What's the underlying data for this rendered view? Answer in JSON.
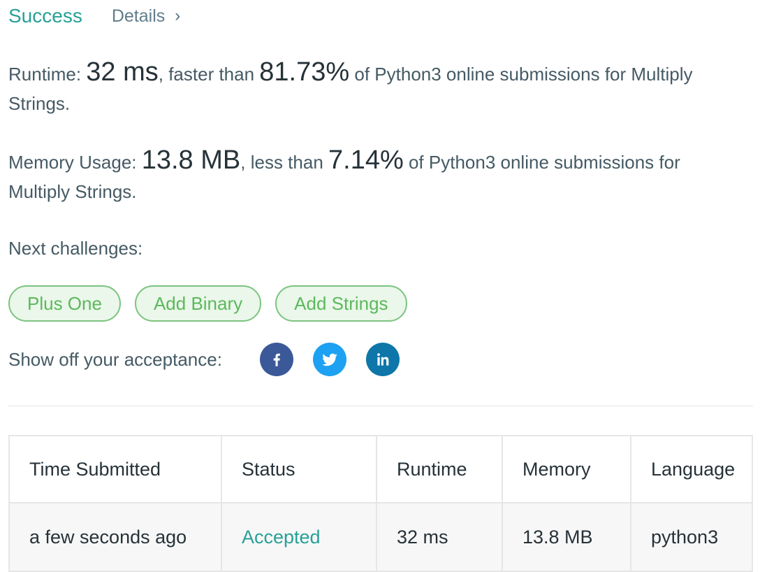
{
  "header": {
    "status": "Success",
    "details_label": "Details",
    "chevron": "›"
  },
  "runtime": {
    "label": "Runtime: ",
    "value": "32 ms",
    "compare": ", faster than ",
    "percent": "81.73%",
    "tail": " of Python3 online submissions for Multiply Strings."
  },
  "memory": {
    "label": "Memory Usage: ",
    "value": "13.8 MB",
    "compare": ", less than ",
    "percent": "7.14%",
    "tail": " of Python3 online submissions for Multiply Strings."
  },
  "next": {
    "label": "Next challenges:",
    "items": [
      "Plus One",
      "Add Binary",
      "Add Strings"
    ]
  },
  "share": {
    "label": "Show off your acceptance:",
    "icons": [
      "facebook-icon",
      "twitter-icon",
      "linkedin-icon"
    ]
  },
  "table": {
    "headers": [
      "Time Submitted",
      "Status",
      "Runtime",
      "Memory",
      "Language"
    ],
    "row": [
      "a few seconds ago",
      "Accepted",
      "32 ms",
      "13.8 MB",
      "python3"
    ]
  },
  "colors": {
    "accent": "#26a197",
    "chip_text": "#5cb85c",
    "facebook": "#3b5998",
    "twitter": "#1da1f2",
    "linkedin": "#0e76a8"
  }
}
